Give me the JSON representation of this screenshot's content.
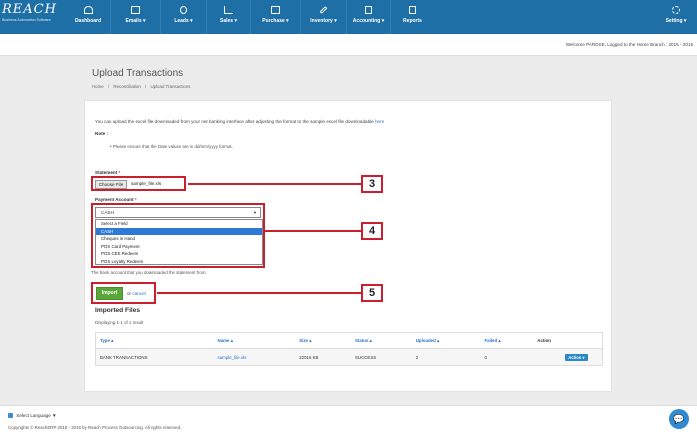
{
  "topbar": {
    "logo_text": "REACH",
    "logo_sub": "Business Automation Software",
    "nav": [
      {
        "label": "Dashboard",
        "icon": "dashboard-icon"
      },
      {
        "label": "Emails ▾",
        "icon": "mail-icon"
      },
      {
        "label": "Leads ▾",
        "icon": "leads-icon"
      },
      {
        "label": "Sales ▾",
        "icon": "bar-chart-icon"
      },
      {
        "label": "Purchase ▾",
        "icon": "money-icon"
      },
      {
        "label": "Inventory ▾",
        "icon": "wrench-icon"
      },
      {
        "label": "Accounting ▾",
        "icon": "calculator-icon"
      },
      {
        "label": "Reports",
        "icon": "report-icon"
      }
    ],
    "settings_label": "Setting ▾"
  },
  "subheader": {
    "welcome": "Welcome PARDSE, Logged to the Home Branch : 2015 - 2016"
  },
  "page": {
    "title": "Upload Transactions",
    "breadcrumb": [
      "Home",
      "/",
      "Reconciliation",
      "/",
      "Upload Transactions"
    ]
  },
  "form": {
    "intro": "You can upload the excel file downloaded from your net banking interface after adjusting the format to the sample excel file downloadable",
    "intro_link": "here",
    "note_heading": "Note :",
    "note_bullet": "• Please ensure that the Date values are in dd/mm/yyyy format.",
    "statement_label": "Statement",
    "required_mark": "*",
    "choose_file_label": "Choose File",
    "file_name": "sample_file.xls",
    "payment_label": "Payment Account",
    "payment_selected": "CASH",
    "payment_options": [
      "Select a Field",
      "CASH",
      "Cheques in Hand",
      "POS Card Payment",
      "POS CEE Redeem",
      "POS Loyalty Redeem"
    ],
    "payment_selected_index": 1,
    "help_text": "The bank account that you downloaded the statement from.",
    "import_label": "Import",
    "or_text": "or",
    "cancel_label": "cancel"
  },
  "callouts": [
    "3",
    "4",
    "5"
  ],
  "imported": {
    "heading": "Imported Files",
    "displaying": "Displaying 1-1 of 1 result",
    "columns": [
      "Type ▴",
      "Name ▴",
      "Size ▴",
      "Status ▴",
      "Uploaded ▴",
      "Failed ▴",
      "Action"
    ],
    "rows": [
      {
        "type": "BANK TRANSACTIONS",
        "name": "sample_file.xls",
        "size": "22016 KB",
        "status": "SUCCESS",
        "uploaded": "2",
        "failed": "0",
        "action": "Action ▾"
      }
    ]
  },
  "footer": {
    "language": "Select Language ▼",
    "copyright": "Copyrights © ReachERP 2015 - 2016 by Reach Process Outsourcing. All rights reserved."
  },
  "colors": {
    "nav_bg": "#1e6fa6",
    "callout_red": "#c8202e",
    "import_green": "#5aa63a",
    "link_blue": "#2a72c8"
  }
}
